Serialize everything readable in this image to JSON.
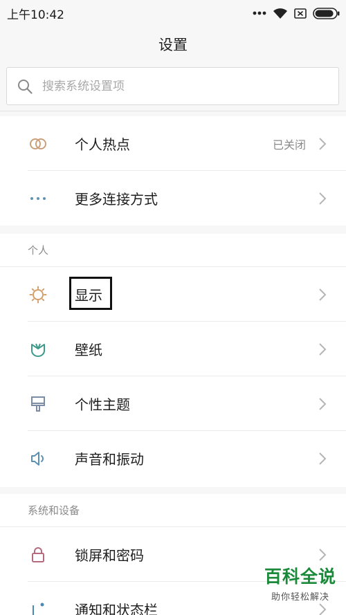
{
  "status": {
    "time": "上午10:42",
    "battery_level": 0.9
  },
  "header": {
    "title": "设置"
  },
  "search": {
    "placeholder": "搜索系统设置项",
    "icon": "search-icon"
  },
  "connection": {
    "items": [
      {
        "label": "个人热点",
        "value": "已关闭",
        "icon": "hotspot-icon",
        "icon_color": "#c9a07a"
      },
      {
        "label": "更多连接方式",
        "value": "",
        "icon": "more-dots-icon",
        "icon_color": "#5e93b3"
      }
    ]
  },
  "personal": {
    "header": "个人",
    "items": [
      {
        "label": "显示",
        "icon": "brightness-icon",
        "icon_color": "#d3a06b"
      },
      {
        "label": "壁纸",
        "icon": "wallpaper-icon",
        "icon_color": "#3f9a8a"
      },
      {
        "label": "个性主题",
        "icon": "theme-brush-icon",
        "icon_color": "#7d8aa3"
      },
      {
        "label": "声音和振动",
        "icon": "speaker-icon",
        "icon_color": "#5b8fb0"
      }
    ]
  },
  "system": {
    "header": "系统和设备",
    "items": [
      {
        "label": "锁屏和密码",
        "icon": "lock-icon",
        "icon_color": "#b56a7d"
      },
      {
        "label": "通知和状态栏",
        "icon": "notification-icon",
        "icon_color": "#4a8ab0"
      }
    ]
  },
  "watermark": {
    "title": "百科全说",
    "subtitle": "助你轻松解决"
  }
}
